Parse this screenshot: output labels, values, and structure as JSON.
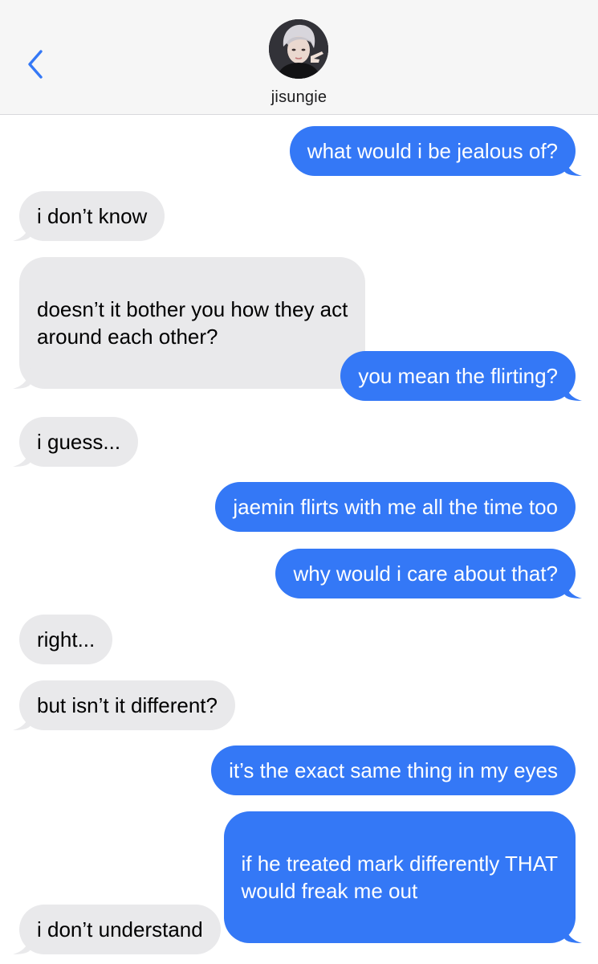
{
  "header": {
    "contact_name": "jisungie",
    "back_icon": "chevron-left-icon",
    "avatar_icon": "contact-avatar"
  },
  "colors": {
    "sent_bubble": "#3478f6",
    "received_bubble": "#e9e9eb",
    "accent": "#3478f6",
    "header_bg": "#f6f6f6"
  },
  "messages": [
    {
      "direction": "sent",
      "text": "what would i be jealous of?"
    },
    {
      "direction": "received",
      "text": "i don’t know"
    },
    {
      "direction": "received",
      "text": "doesn’t it bother you how they act\naround each other?"
    },
    {
      "direction": "sent",
      "text": "you mean the flirting?"
    },
    {
      "direction": "received",
      "text": "i guess..."
    },
    {
      "direction": "sent",
      "text": "jaemin flirts with me all the time too"
    },
    {
      "direction": "sent",
      "text": "why would i care about that?"
    },
    {
      "direction": "received",
      "text": "right..."
    },
    {
      "direction": "received",
      "text": "but isn’t it different?"
    },
    {
      "direction": "sent",
      "text": "it’s the exact same thing in my eyes"
    },
    {
      "direction": "sent",
      "text": "if he treated mark differently THAT\nwould freak me out"
    },
    {
      "direction": "received",
      "text": "i don’t understand"
    }
  ]
}
